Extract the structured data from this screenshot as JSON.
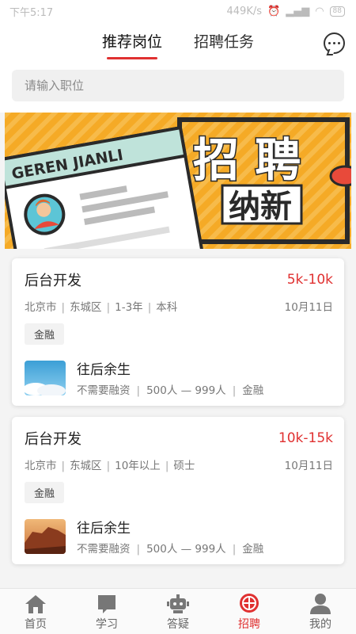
{
  "status_bar": {
    "time": "下午5:17",
    "network_speed": "449K/s",
    "battery": "88"
  },
  "header": {
    "tabs": [
      {
        "label": "推荐岗位",
        "active": true
      },
      {
        "label": "招聘任务",
        "active": false
      }
    ],
    "chat_icon": "chat-bubble-icon"
  },
  "search": {
    "placeholder": "请输入职位"
  },
  "banner": {
    "badge": "GEREN JIANLI",
    "line1": "招 聘",
    "line2": "纳新"
  },
  "jobs": [
    {
      "title": "后台开发",
      "salary": "5k-10k",
      "city": "北京市",
      "district": "东城区",
      "experience": "1-3年",
      "education": "本科",
      "date": "10月11日",
      "tag": "金融",
      "company": {
        "name": "往后余生",
        "funding": "不需要融资",
        "size": "500人 — 999人",
        "industry": "金融"
      }
    },
    {
      "title": "后台开发",
      "salary": "10k-15k",
      "city": "北京市",
      "district": "东城区",
      "experience": "10年以上",
      "education": "硕士",
      "date": "10月11日",
      "tag": "金融",
      "company": {
        "name": "往后余生",
        "funding": "不需要融资",
        "size": "500人 — 999人",
        "industry": "金融"
      }
    }
  ],
  "tabbar": [
    {
      "label": "首页",
      "icon": "home-icon",
      "active": false
    },
    {
      "label": "学习",
      "icon": "book-icon",
      "active": false
    },
    {
      "label": "答疑",
      "icon": "robot-icon",
      "active": false
    },
    {
      "label": "招聘",
      "icon": "recruit-icon",
      "active": true
    },
    {
      "label": "我的",
      "icon": "user-icon",
      "active": false
    }
  ],
  "colors": {
    "accent": "#e03131",
    "banner_yellow": "#f5aa26"
  }
}
